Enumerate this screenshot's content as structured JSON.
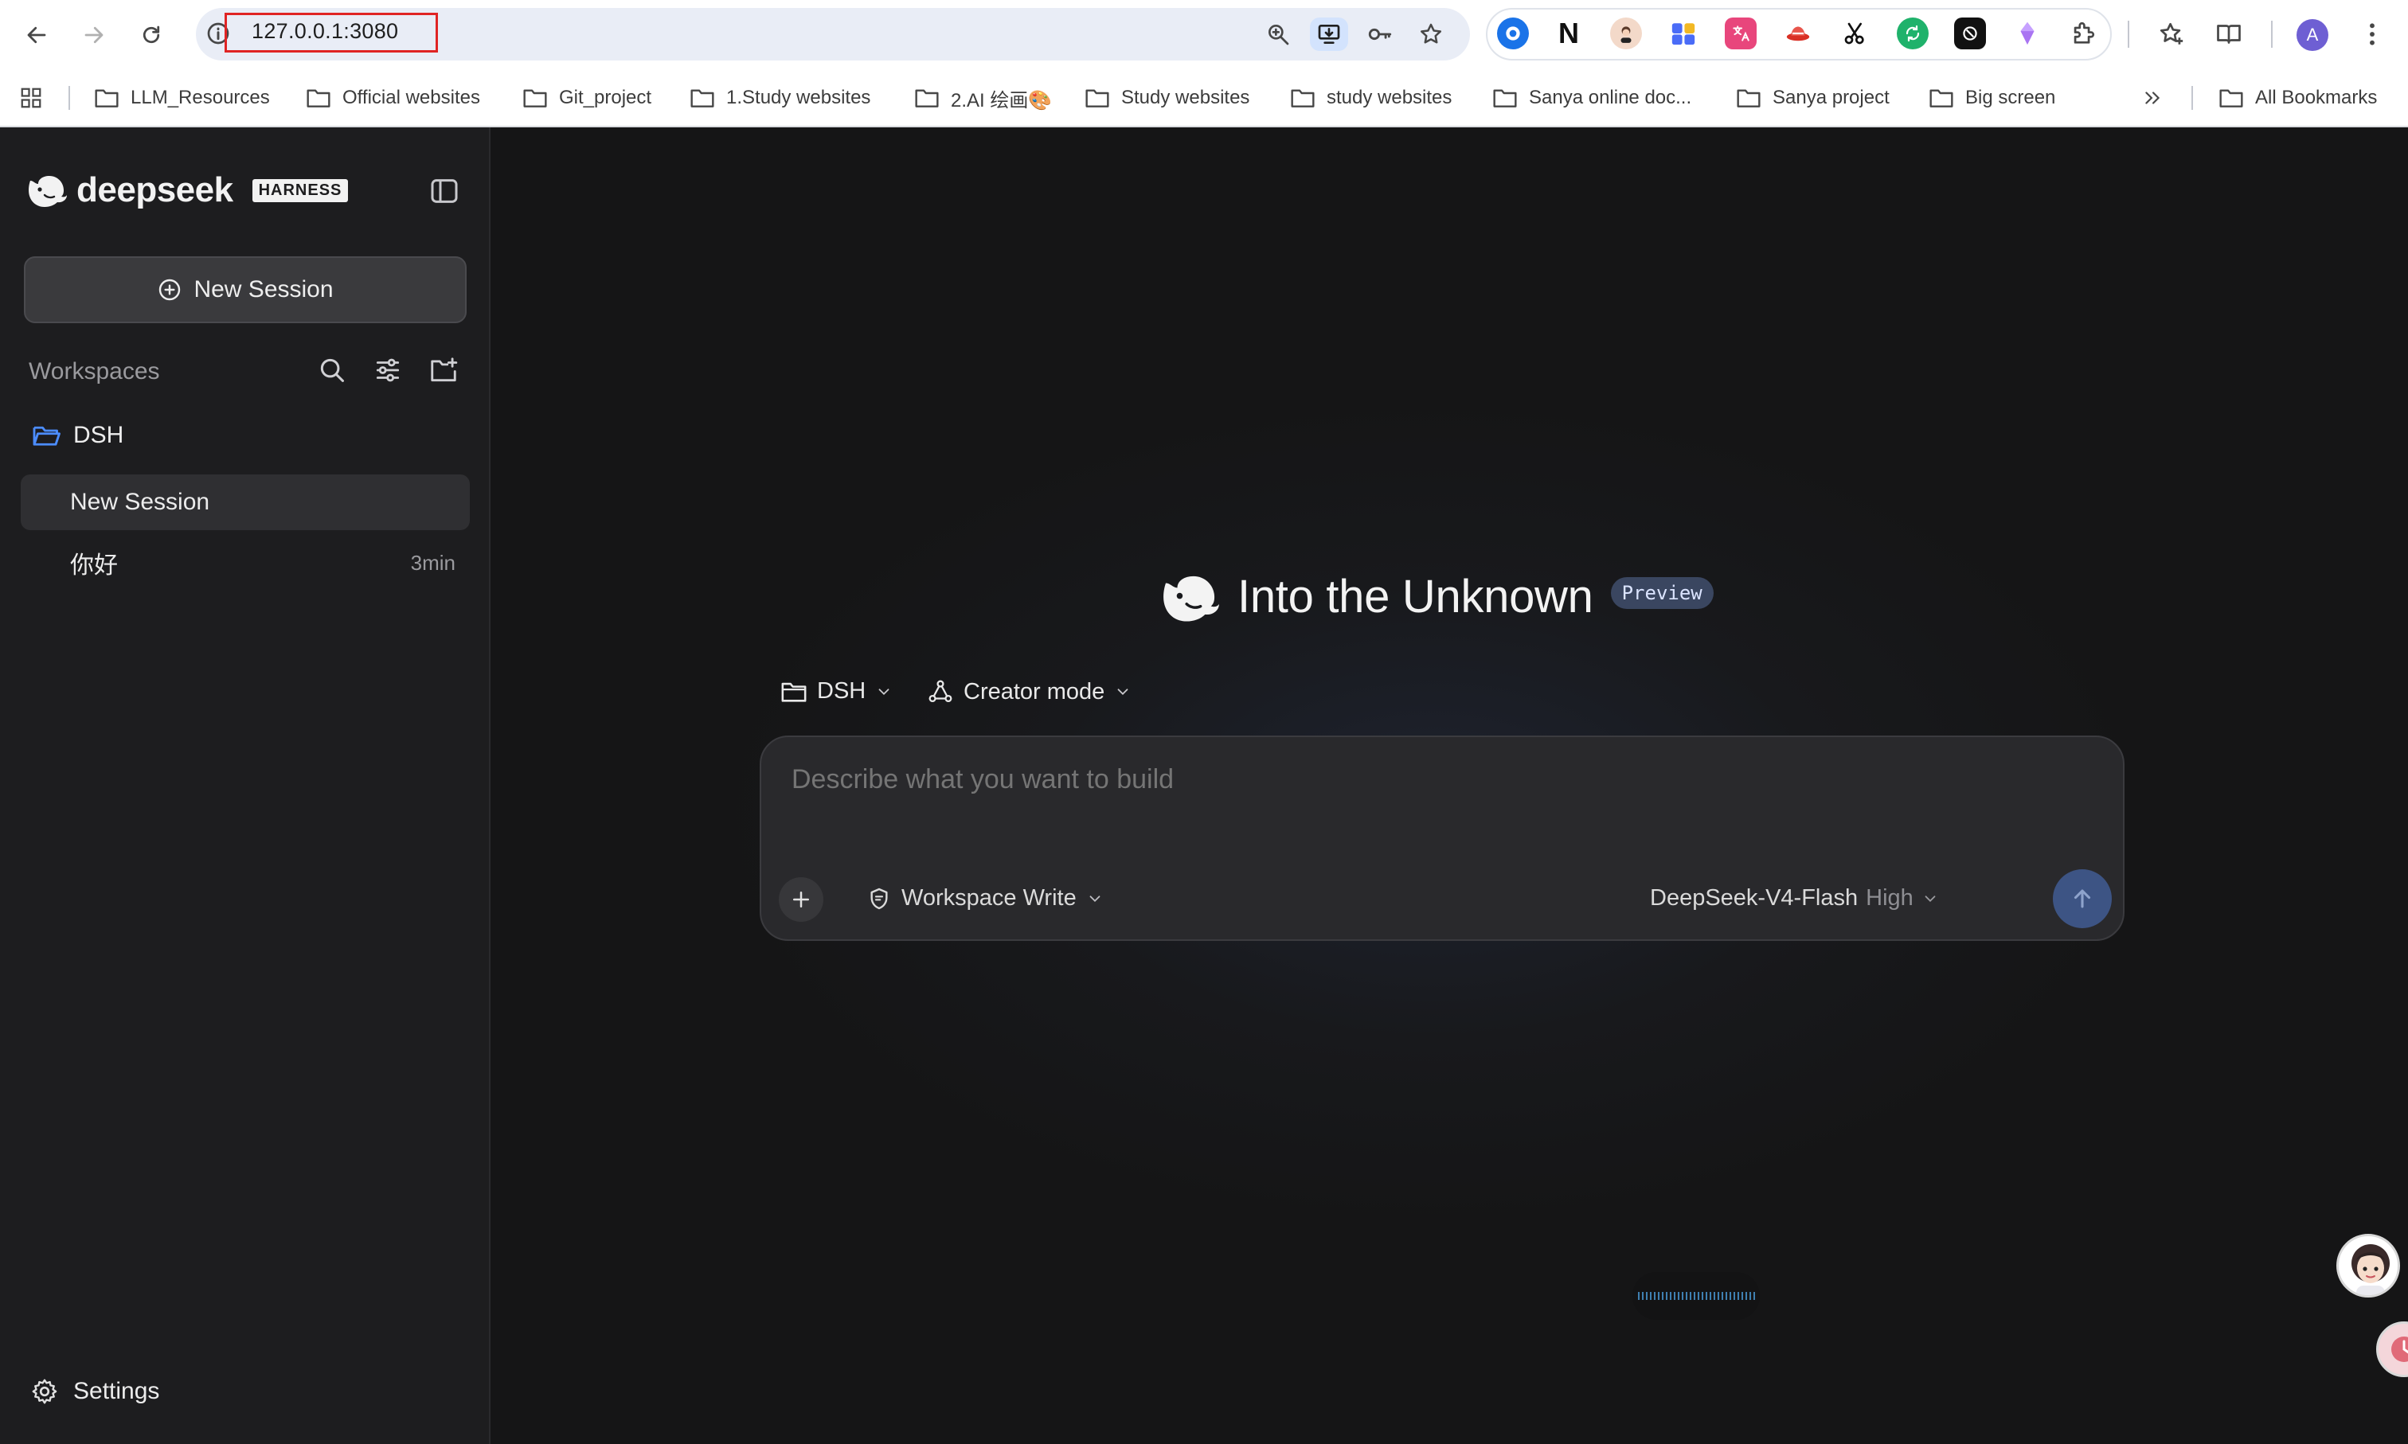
{
  "browser": {
    "url": "127.0.0.1:3080",
    "bookmarks": [
      {
        "label": "LLM_Resources"
      },
      {
        "label": "Official websites"
      },
      {
        "label": "Git_project"
      },
      {
        "label": "1.Study websites"
      },
      {
        "label": "2.AI 绘画🎨"
      },
      {
        "label": "Study websites"
      },
      {
        "label": "study websites"
      },
      {
        "label": "Sanya online doc..."
      },
      {
        "label": "Sanya project"
      },
      {
        "label": "Big screen"
      }
    ],
    "all_bookmarks": "All Bookmarks",
    "profile_initial": "A",
    "extension_letter": "N"
  },
  "sidebar": {
    "brand": "deepseek",
    "badge": "HARNESS",
    "new_session": "New Session",
    "workspaces_label": "Workspaces",
    "workspace": "DSH",
    "sessions": [
      {
        "title": "New Session",
        "time": ""
      },
      {
        "title": "你好",
        "time": "3min"
      }
    ],
    "settings": "Settings"
  },
  "main": {
    "title": "Into the Unknown",
    "badge": "Preview",
    "workspace_picker": "DSH",
    "mode_picker": "Creator mode",
    "composer": {
      "placeholder": "Describe what you want to build",
      "permission": "Workspace Write",
      "model": "DeepSeek-V4-Flash",
      "level": "High"
    }
  },
  "colors": {
    "sidebar_bg": "#1d1d1f",
    "main_bg": "#151516",
    "accent": "#3d5484",
    "url_highlight": "#e02424"
  }
}
